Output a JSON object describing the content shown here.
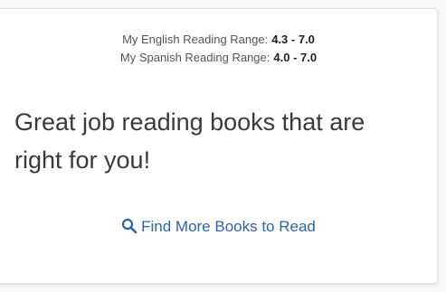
{
  "ranges": {
    "english_label": "My English Reading Range:",
    "english_value": "4.3 - 7.0",
    "spanish_label": "My Spanish Reading Range:",
    "spanish_value": "4.0 - 7.0"
  },
  "message": "Great job reading books that are right for you!",
  "link": {
    "label": "Find More Books to Read",
    "icon": "search-icon"
  },
  "colors": {
    "link": "#2f63b0",
    "text": "#3a3a3a",
    "muted": "#50555c"
  }
}
